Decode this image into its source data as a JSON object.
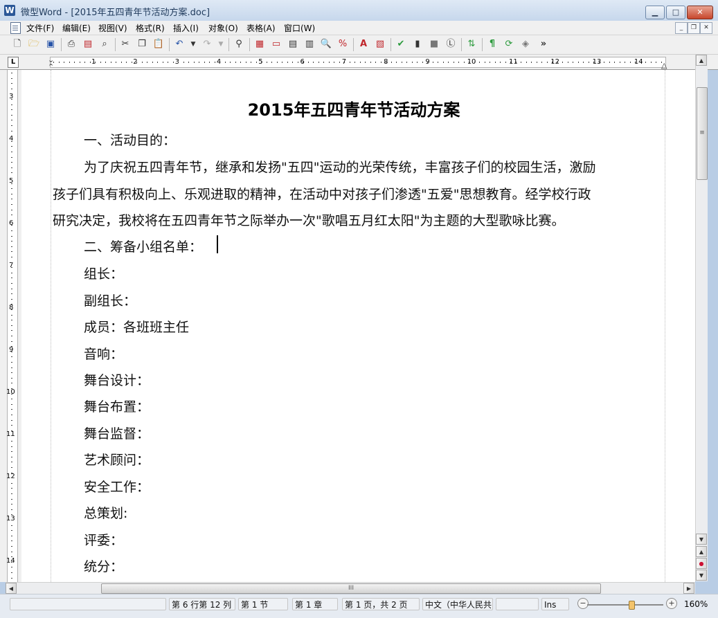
{
  "window": {
    "app_icon": "W",
    "title": "微型Word - [2015年五四青年节活动方案.doc]",
    "minimize_glyph": "▁",
    "maximize_glyph": "□",
    "close_glyph": "✕"
  },
  "menu": {
    "items": [
      "文件(F)",
      "编辑(E)",
      "视图(V)",
      "格式(R)",
      "插入(I)",
      "对象(O)",
      "表格(A)",
      "窗口(W)"
    ],
    "mdi_minimize": "_",
    "mdi_restore": "❐",
    "mdi_close": "✕"
  },
  "toolbar": {
    "icons": [
      "new-icon",
      "open-icon",
      "save-icon",
      "print-icon",
      "pdf-icon",
      "print-preview-icon",
      "cut-icon",
      "copy-icon",
      "paste-icon",
      "undo-icon",
      "redo-icon",
      "find-icon",
      "insert-table-icon",
      "insert-frame-icon",
      "insert-textbox-icon",
      "columns-icon",
      "zoom-icon",
      "zoom-percent-icon",
      "font-color-icon",
      "format-icon",
      "spellcheck-icon",
      "chart-icon",
      "shape-icon",
      "letter-icon",
      "sync-icon",
      "paragraph-mark-icon",
      "track-changes-icon",
      "layers-icon"
    ],
    "overflow": "»"
  },
  "ruler": {
    "corner_label": "L",
    "h_numbers": [
      "1",
      "2",
      "3",
      "4",
      "5",
      "6",
      "7",
      "8",
      "9",
      "10",
      "11",
      "12",
      "13",
      "14"
    ],
    "v_numbers": [
      "3",
      "4",
      "5",
      "6",
      "7",
      "8",
      "9",
      "10",
      "11",
      "12",
      "13",
      "14"
    ]
  },
  "document": {
    "title": "2015年五四青年节活动方案",
    "lines": [
      "一、活动目的：",
      "为了庆祝五四青年节，继承和发扬\"五四\"运动的光荣传统，丰富孩子们的校园生活，激励",
      "孩子们具有积极向上、乐观进取的精神，在活动中对孩子们渗透\"五爱\"思想教育。经学校行政",
      "研究决定，我校将在五四青年节之际举办一次\"歌唱五月红太阳\"为主题的大型歌咏比赛。",
      "二、筹备小组名单：",
      "组长：",
      "副组长：",
      "成员：各班班主任",
      "音响：",
      "舞台设计：",
      "舞台布置：",
      "舞台监督：",
      "艺术顾问：",
      "安全工作：",
      "总策划:",
      "评委：",
      "统分："
    ]
  },
  "scrollbar": {
    "up": "▲",
    "down": "▼",
    "grip": "≡",
    "prev_page": "▲",
    "browse_object": "●",
    "next_page": "▼",
    "left": "◀",
    "right": "▶",
    "h_grip": "III"
  },
  "status": {
    "position": "第 6 行第 12 列",
    "section": "第 1 节",
    "chapter": "第 1 章",
    "page": "第 1 页，共 2 页",
    "language": "中文（中华人民共",
    "mode": "Ins",
    "zoom_out": "−",
    "zoom_in": "+",
    "zoom_level": "160%"
  },
  "colors": {
    "title_accent": "#1e395b",
    "browse_dot": "#cc1133",
    "zoom_thumb": "#f3c36b"
  }
}
